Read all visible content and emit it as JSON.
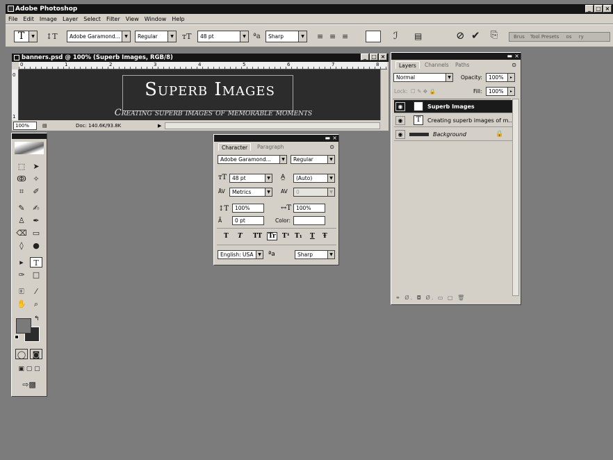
{
  "app": {
    "title": "Adobe Photoshop"
  },
  "menu": [
    "File",
    "Edit",
    "Image",
    "Layer",
    "Select",
    "Filter",
    "View",
    "Window",
    "Help"
  ],
  "options": {
    "font_family": "Adobe Garamond...",
    "font_style": "Regular",
    "font_size": "48 pt",
    "antialias": "Sharp",
    "palette_tabs": [
      "Brus",
      "Tool Presets",
      "os",
      "ry"
    ]
  },
  "document": {
    "title": "banners.psd @ 100% (Superb Images, RGB/8)",
    "headline": "Superb Images",
    "subline": "Creating superb images of memorable moments",
    "zoom": "100%",
    "doc_size": "Doc: 140.6K/93.8K",
    "ruler_marks": [
      "0",
      "1",
      "2",
      "3",
      "4",
      "5",
      "6",
      "7",
      "8"
    ]
  },
  "character": {
    "tabs": [
      "Character",
      "Paragraph"
    ],
    "font_family": "Adobe Garamond...",
    "font_style": "Regular",
    "size": "48 pt",
    "leading": "(Auto)",
    "kerning": "Metrics",
    "tracking": "0",
    "vscale": "100%",
    "hscale": "100%",
    "baseline": "0 pt",
    "color_label": "Color:",
    "language": "English: USA",
    "antialias": "Sharp",
    "format_buttons": [
      "T",
      "T",
      "TT",
      "Tr",
      "T¹",
      "T₁",
      "T",
      "Ŧ"
    ]
  },
  "layers": {
    "tabs": [
      "Layers",
      "Channels",
      "Paths"
    ],
    "blend_mode": "Normal",
    "opacity_label": "Opacity:",
    "opacity": "100%",
    "lock_label": "Lock:",
    "fill_label": "Fill:",
    "fill": "100%",
    "items": [
      {
        "name": "Superb Images",
        "type": "text",
        "selected": true
      },
      {
        "name": "Creating superb images of m...",
        "type": "text",
        "selected": false
      },
      {
        "name": "Background",
        "type": "raster",
        "selected": false
      }
    ]
  },
  "colors": {
    "foreground": "#7a7a7a",
    "background": "#2c2c2c",
    "workspace": "#7c7c7c"
  }
}
